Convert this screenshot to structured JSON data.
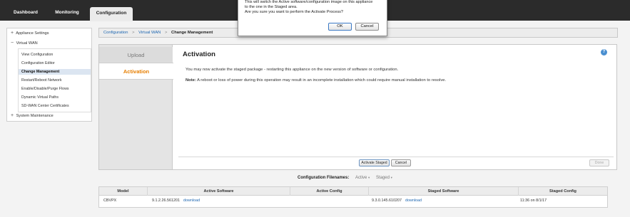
{
  "topnav": {
    "tabs": [
      {
        "label": "Dashboard"
      },
      {
        "label": "Monitoring"
      },
      {
        "label": "Configuration"
      }
    ]
  },
  "leftnav": {
    "appliance_settings": "Appliance Settings",
    "virtual_wan": "Virtual WAN",
    "items": [
      {
        "label": "View Configuration"
      },
      {
        "label": "Configuration Editor"
      },
      {
        "label": "Change Management"
      },
      {
        "label": "Restart/Reboot Network"
      },
      {
        "label": "Enable/Disable/Purge Flows"
      },
      {
        "label": "Dynamic Virtual Paths"
      },
      {
        "label": "SD-WAN Center Certificates"
      }
    ],
    "system_maintenance": "System Maintenance",
    "plus": "+",
    "minus": "−"
  },
  "breadcrumb": {
    "items": [
      "Configuration",
      "Virtual WAN",
      "Change Management"
    ],
    "separator": ">"
  },
  "main": {
    "tabs": {
      "upload": "Upload",
      "activation": "Activation"
    },
    "title": "Activation",
    "help": "?",
    "message": "You may now activate the staged package - restarting this appliance on the new version of software or configuration.",
    "note_label": "Note:",
    "note_text": " A reboot or loss of power during this operation may result in an incomplete installation which could require manual installation to resolve.",
    "buttons": {
      "activate": "Activate Staged",
      "cancel": "Cancel",
      "done": "Done"
    }
  },
  "filenames": {
    "label": "Configuration Filenames:",
    "active": "Active",
    "staged": "Staged",
    "caret": "▾"
  },
  "table": {
    "headers": [
      "Model",
      "Active Software",
      "Active Config",
      "Staged Software",
      "Staged Config"
    ],
    "row": {
      "model": "CBVPX",
      "active_software": "9.1.2.26.561201",
      "active_download": "download",
      "active_config": "",
      "staged_software": "9.3.0.145.610207",
      "staged_download": "download",
      "staged_config": "11:36 on 8/1/17"
    }
  },
  "dialog": {
    "line1": "This will switch the Active software/configuration image on this appliance",
    "line2": "to the one in the Staged area.",
    "line3": "Are you sure you want to perform the Activate Process?",
    "ok": "OK",
    "cancel": "Cancel"
  },
  "colors": {
    "accent_orange": "#e67e00",
    "link_blue": "#1f67b1",
    "topbar": "#2b2b2b"
  }
}
